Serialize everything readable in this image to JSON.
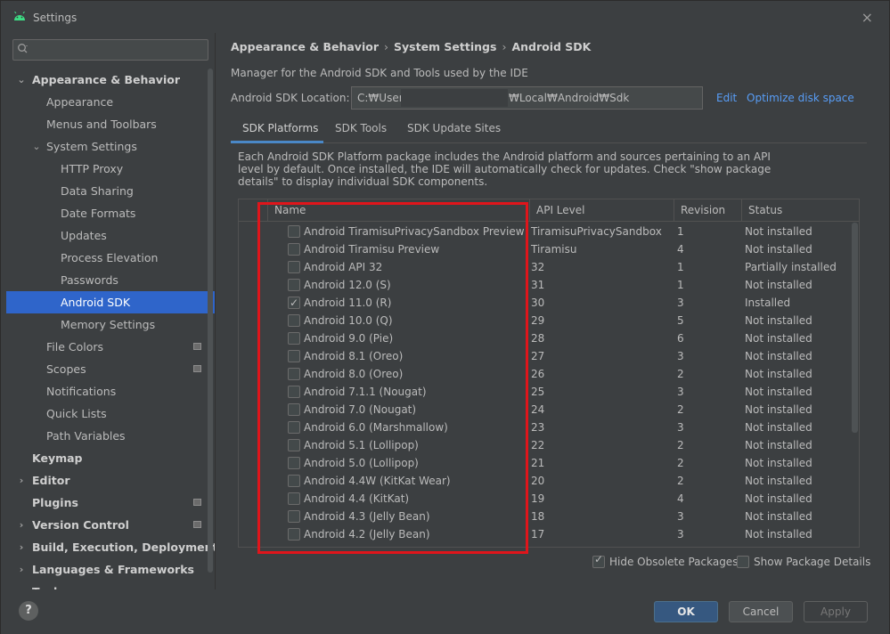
{
  "window": {
    "title": "Settings",
    "close_glyph": "×"
  },
  "search": {
    "value": "",
    "placeholder": ""
  },
  "sidebar": {
    "items": [
      {
        "label": "Appearance & Behavior"
      },
      {
        "label": "Appearance"
      },
      {
        "label": "Menus and Toolbars"
      },
      {
        "label": "System Settings"
      },
      {
        "label": "HTTP Proxy"
      },
      {
        "label": "Data Sharing"
      },
      {
        "label": "Date Formats"
      },
      {
        "label": "Updates"
      },
      {
        "label": "Process Elevation"
      },
      {
        "label": "Passwords"
      },
      {
        "label": "Android SDK"
      },
      {
        "label": "Memory Settings"
      },
      {
        "label": "File Colors"
      },
      {
        "label": "Scopes"
      },
      {
        "label": "Notifications"
      },
      {
        "label": "Quick Lists"
      },
      {
        "label": "Path Variables"
      },
      {
        "label": "Keymap"
      },
      {
        "label": "Editor"
      },
      {
        "label": "Plugins"
      },
      {
        "label": "Version Control"
      },
      {
        "label": "Build, Execution, Deployment"
      },
      {
        "label": "Languages & Frameworks"
      },
      {
        "label": "Tools"
      }
    ],
    "arrow_open": "⌄",
    "arrow_closed": "›"
  },
  "breadcrumb": [
    "Appearance & Behavior",
    "System Settings",
    "Android SDK"
  ],
  "breadcrumb_sep": "›",
  "description": "Manager for the Android SDK and Tools used by the IDE",
  "sdk_location": {
    "label": "Android SDK Location:",
    "value_start": "C:₩Users",
    "value_end": "₩Local₩Android₩Sdk",
    "edit": "Edit",
    "optimize": "Optimize disk space"
  },
  "tabs": [
    "SDK Platforms",
    "SDK Tools",
    "SDK Update Sites"
  ],
  "info_text": "Each Android SDK Platform package includes the Android platform and sources pertaining to an API level by default. Once installed, the IDE will automatically check for updates. Check \"show package details\" to display individual SDK components.",
  "table": {
    "headers": [
      "Name",
      "API Level",
      "Revision",
      "Status"
    ],
    "rows": [
      {
        "name": "Android TiramisuPrivacySandbox Preview",
        "api": "TiramisuPrivacySandbox",
        "rev": "1",
        "status": "Not installed",
        "checked": false
      },
      {
        "name": "Android Tiramisu Preview",
        "api": "Tiramisu",
        "rev": "4",
        "status": "Not installed",
        "checked": false
      },
      {
        "name": "Android API 32",
        "api": "32",
        "rev": "1",
        "status": "Partially installed",
        "checked": false
      },
      {
        "name": "Android 12.0 (S)",
        "api": "31",
        "rev": "1",
        "status": "Not installed",
        "checked": false
      },
      {
        "name": "Android 11.0 (R)",
        "api": "30",
        "rev": "3",
        "status": "Installed",
        "checked": true
      },
      {
        "name": "Android 10.0 (Q)",
        "api": "29",
        "rev": "5",
        "status": "Not installed",
        "checked": false
      },
      {
        "name": "Android 9.0 (Pie)",
        "api": "28",
        "rev": "6",
        "status": "Not installed",
        "checked": false
      },
      {
        "name": "Android 8.1 (Oreo)",
        "api": "27",
        "rev": "3",
        "status": "Not installed",
        "checked": false
      },
      {
        "name": "Android 8.0 (Oreo)",
        "api": "26",
        "rev": "2",
        "status": "Not installed",
        "checked": false
      },
      {
        "name": "Android 7.1.1 (Nougat)",
        "api": "25",
        "rev": "3",
        "status": "Not installed",
        "checked": false
      },
      {
        "name": "Android 7.0 (Nougat)",
        "api": "24",
        "rev": "2",
        "status": "Not installed",
        "checked": false
      },
      {
        "name": "Android 6.0 (Marshmallow)",
        "api": "23",
        "rev": "3",
        "status": "Not installed",
        "checked": false
      },
      {
        "name": "Android 5.1 (Lollipop)",
        "api": "22",
        "rev": "2",
        "status": "Not installed",
        "checked": false
      },
      {
        "name": "Android 5.0 (Lollipop)",
        "api": "21",
        "rev": "2",
        "status": "Not installed",
        "checked": false
      },
      {
        "name": "Android 4.4W (KitKat Wear)",
        "api": "20",
        "rev": "2",
        "status": "Not installed",
        "checked": false
      },
      {
        "name": "Android 4.4 (KitKat)",
        "api": "19",
        "rev": "4",
        "status": "Not installed",
        "checked": false
      },
      {
        "name": "Android 4.3 (Jelly Bean)",
        "api": "18",
        "rev": "3",
        "status": "Not installed",
        "checked": false
      },
      {
        "name": "Android 4.2 (Jelly Bean)",
        "api": "17",
        "rev": "3",
        "status": "Not installed",
        "checked": false
      }
    ]
  },
  "options": {
    "hide_obsolete": {
      "label": "Hide Obsolete Packages",
      "checked": true
    },
    "show_details": {
      "label": "Show Package Details",
      "checked": false
    }
  },
  "buttons": {
    "help": "?",
    "ok": "OK",
    "cancel": "Cancel",
    "apply": "Apply"
  },
  "colors": {
    "accent": "#2f65ca",
    "highlight_border": "#e0151b",
    "link": "#589df6",
    "primary_button": "#365880",
    "android_green": "#3ddc84"
  }
}
